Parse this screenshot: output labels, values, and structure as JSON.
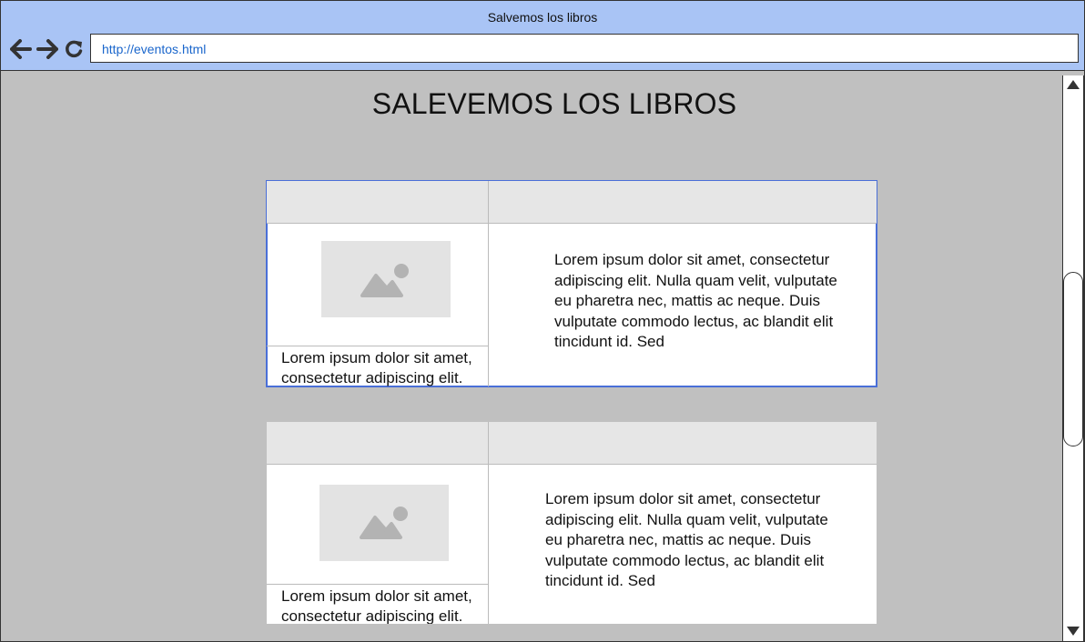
{
  "window": {
    "title": "Salvemos los libros"
  },
  "toolbar": {
    "url": "http://eventos.html",
    "back_icon": "arrow-left-icon",
    "forward_icon": "arrow-right-icon",
    "reload_icon": "reload-icon"
  },
  "page": {
    "heading": "SALEVEMOS LOS LIBROS"
  },
  "events": [
    {
      "image_icon": "image-placeholder-icon",
      "caption": "Lorem ipsum dolor sit amet, consectetur adipiscing elit.",
      "description": "Lorem ipsum dolor sit amet, consectetur adipiscing elit. Nulla quam velit, vulputate eu pharetra nec, mattis ac neque. Duis vulputate commodo lectus, ac blandit elit tincidunt id. Sed"
    },
    {
      "image_icon": "image-placeholder-icon",
      "caption": "Lorem ipsum dolor sit amet, consectetur adipiscing elit.",
      "description": "Lorem ipsum dolor sit amet, consectetur adipiscing elit. Nulla quam velit, vulputate eu pharetra nec, mattis ac neque. Duis vulputate commodo lectus, ac blandit elit tincidunt id. Sed"
    }
  ],
  "colors": {
    "titlebar": "#a9c4f5",
    "page_background": "#c0c0c0",
    "selection_outline": "#4a6fd8",
    "url_text": "#1a66cc"
  }
}
